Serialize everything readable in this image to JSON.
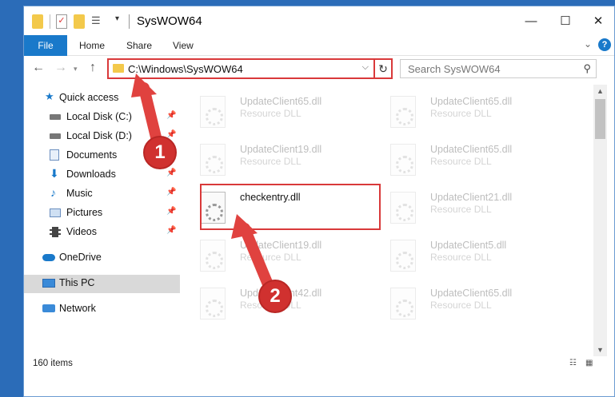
{
  "window": {
    "title": "SysWOW64"
  },
  "ribbon": {
    "file": "File",
    "home": "Home",
    "share": "Share",
    "view": "View"
  },
  "address": {
    "path": "C:\\Windows\\SysWOW64"
  },
  "search": {
    "placeholder": "Search SysWOW64"
  },
  "sidebar": {
    "items": [
      {
        "label": "Quick access",
        "icon": "star-icon",
        "pin": false
      },
      {
        "label": "Local Disk (C:)",
        "icon": "drive-icon",
        "pin": true
      },
      {
        "label": "Local Disk (D:)",
        "icon": "drive-icon",
        "pin": true
      },
      {
        "label": "Documents",
        "icon": "documents-icon",
        "pin": true
      },
      {
        "label": "Downloads",
        "icon": "download-icon",
        "pin": true
      },
      {
        "label": "Music",
        "icon": "music-icon",
        "pin": true
      },
      {
        "label": "Pictures",
        "icon": "pictures-icon",
        "pin": true
      },
      {
        "label": "Videos",
        "icon": "videos-icon",
        "pin": true
      },
      {
        "label": "OneDrive",
        "icon": "cloud-icon",
        "pin": false
      },
      {
        "label": "This PC",
        "icon": "pc-icon",
        "pin": false
      },
      {
        "label": "Network",
        "icon": "network-icon",
        "pin": false
      }
    ]
  },
  "files": [
    {
      "name": "UpdateClient65.dll",
      "type": "Resource DLL"
    },
    {
      "name": "UpdateClient65.dll",
      "type": "Resource DLL"
    },
    {
      "name": "UpdateClient19.dll",
      "type": "Resource DLL"
    },
    {
      "name": "UpdateClient65.dll",
      "type": "Resource DLL"
    },
    {
      "name": "checkentry.dll",
      "type": ""
    },
    {
      "name": "UpdateClient21.dll",
      "type": "Resource DLL"
    },
    {
      "name": "UpdateClient19.dll",
      "type": "Resource DLL"
    },
    {
      "name": "UpdateClient5.dll",
      "type": "Resource DLL"
    },
    {
      "name": "UpdateClient42.dll",
      "type": "Resource DLL"
    },
    {
      "name": "UpdateClient65.dll",
      "type": "Resource DLL"
    }
  ],
  "status": {
    "count": "160 items"
  },
  "annotations": {
    "step1": "1",
    "step2": "2"
  },
  "colors": {
    "accent": "#1979ca",
    "highlight": "#d9393a"
  }
}
